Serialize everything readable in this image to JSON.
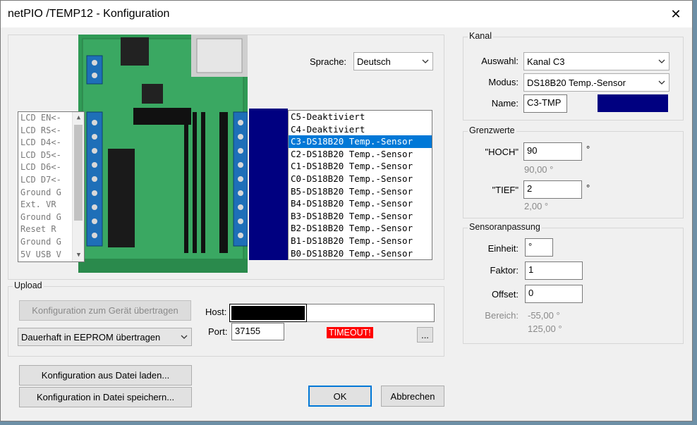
{
  "window": {
    "title": "netPIO /TEMP12 - Konfiguration",
    "close_glyph": "✕"
  },
  "board": {
    "pin_list": [
      "LCD EN<-",
      "LCD RS<-",
      "LCD D4<-",
      "LCD D5<-",
      "LCD D6<-",
      "LCD D7<-",
      "Ground G",
      "Ext.  VR",
      "Ground G",
      "Reset  R",
      "Ground G",
      "5V USB V"
    ],
    "language_label": "Sprache:",
    "language_value": "Deutsch",
    "channels": [
      "C5-Deaktiviert",
      "C4-Deaktiviert",
      "C3-DS18B20 Temp.-Sensor",
      "C2-DS18B20 Temp.-Sensor",
      "C1-DS18B20 Temp.-Sensor",
      "C0-DS18B20 Temp.-Sensor",
      "B5-DS18B20 Temp.-Sensor",
      "B4-DS18B20 Temp.-Sensor",
      "B3-DS18B20 Temp.-Sensor",
      "B2-DS18B20 Temp.-Sensor",
      "B1-DS18B20 Temp.-Sensor",
      "B0-DS18B20 Temp.-Sensor"
    ],
    "selected_channel_index": 2,
    "channel_color": "#000080"
  },
  "kanal": {
    "title": "Kanal",
    "auswahl_label": "Auswahl:",
    "auswahl_value": "Kanal C3",
    "modus_label": "Modus:",
    "modus_value": "DS18B20 Temp.-Sensor",
    "name_label": "Name:",
    "name_value": "C3-TMP",
    "color": "#000080"
  },
  "grenzwerte": {
    "title": "Grenzwerte",
    "hoch_label": "\"HOCH\"",
    "hoch_value": "90",
    "hoch_unit": "°",
    "hoch_hint": "90,00 °",
    "tief_label": "\"TIEF\"",
    "tief_value": "2",
    "tief_unit": "°",
    "tief_hint": "2,00 °"
  },
  "sensor": {
    "title": "Sensoranpassung",
    "einheit_label": "Einheit:",
    "einheit_value": "°",
    "faktor_label": "Faktor:",
    "faktor_value": "1",
    "offset_label": "Offset:",
    "offset_value": "0",
    "bereich_label": "Bereich:",
    "bereich_min": "-55,00 °",
    "bereich_max": "125,00 °"
  },
  "upload": {
    "title": "Upload",
    "transfer_button": "Konfiguration zum Gerät übertragen",
    "mode_value": "Dauerhaft in EEPROM übertragen",
    "host_label": "Host:",
    "host_value": "",
    "port_label": "Port:",
    "port_value": "37155",
    "status": "TIMEOUT!",
    "more_button": "..."
  },
  "buttons": {
    "load": "Konfiguration aus Datei laden...",
    "save": "Konfiguration in Datei speichern...",
    "ok": "OK",
    "cancel": "Abbrechen"
  }
}
